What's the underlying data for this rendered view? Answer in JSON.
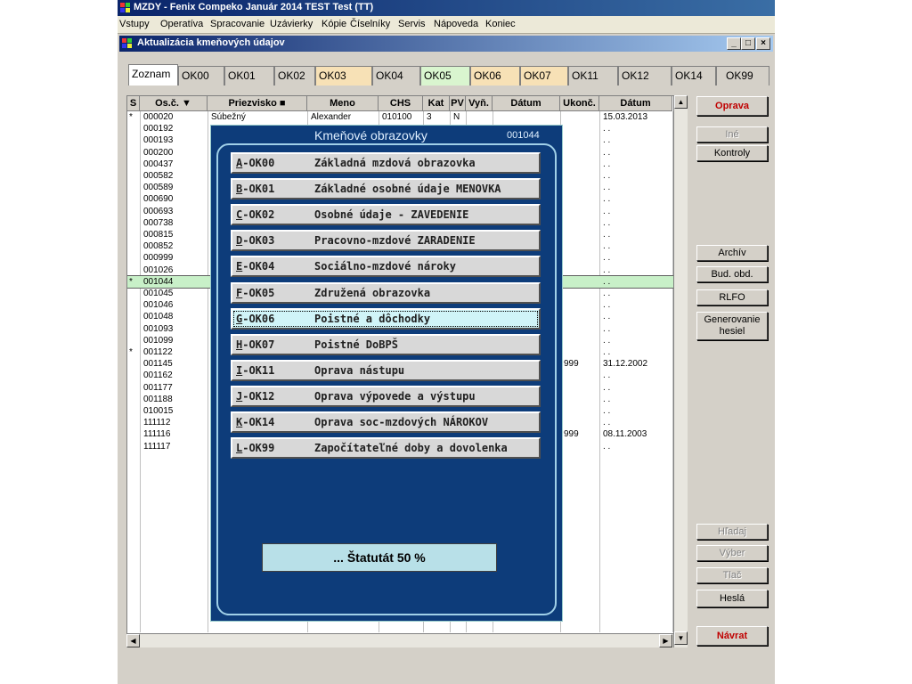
{
  "window": {
    "title": "MZDY - Fenix Compeko Január 2014   TEST Test (TT)"
  },
  "menu": [
    "Vstupy",
    "Operatíva",
    "Spracovanie",
    "Uzávierky",
    "Kópie",
    "Číselníky",
    "Servis",
    "Nápoveda",
    "Koniec"
  ],
  "inner_window": {
    "title": "Aktualizácia kmeňových údajov",
    "minimize": "_",
    "maximize": "□",
    "close": "×"
  },
  "tabs": [
    "Zoznam",
    "OK00",
    "OK01",
    "OK02",
    "OK03",
    "OK04",
    "OK05",
    "OK06",
    "OK07",
    "OK11",
    "OK12",
    "OK14",
    "OK99"
  ],
  "table": {
    "headers": [
      "S",
      "Os.č. ▼",
      "Priezvisko ■",
      "Meno",
      "CHS",
      "Kat",
      "PV",
      "Vyň.",
      "Dátum",
      "Ukonč.",
      "Dátum"
    ],
    "rows": [
      {
        "s": "*",
        "osc": "000020",
        "priezvisko": "Súbežný",
        "meno": "Alexander",
        "chs": "010100",
        "kat": "3",
        "pv": "N",
        "ukonc": "",
        "datum2": "15.03.2013"
      },
      {
        "s": "",
        "osc": "000192",
        "ukonc": "",
        "datum2": ". ."
      },
      {
        "s": "",
        "osc": "000193",
        "ukonc": "",
        "datum2": ". ."
      },
      {
        "s": "",
        "osc": "000200",
        "ukonc": "",
        "datum2": ". ."
      },
      {
        "s": "",
        "osc": "000437",
        "ukonc": "",
        "datum2": ". ."
      },
      {
        "s": "",
        "osc": "000582",
        "ukonc": "",
        "datum2": ". ."
      },
      {
        "s": "",
        "osc": "000589",
        "ukonc": "",
        "datum2": ". ."
      },
      {
        "s": "",
        "osc": "000690",
        "ukonc": "",
        "datum2": ". ."
      },
      {
        "s": "",
        "osc": "000693",
        "ukonc": "",
        "datum2": ". ."
      },
      {
        "s": "",
        "osc": "000738",
        "ukonc": "",
        "datum2": ". ."
      },
      {
        "s": "",
        "osc": "000815",
        "ukonc": "",
        "datum2": ". ."
      },
      {
        "s": "",
        "osc": "000852",
        "ukonc": "",
        "datum2": ". ."
      },
      {
        "s": "",
        "osc": "000999",
        "ukonc": "",
        "datum2": ". ."
      },
      {
        "s": "",
        "osc": "001026",
        "ukonc": "",
        "datum2": ". ."
      },
      {
        "s": "*",
        "osc": "001044",
        "ukonc": "",
        "datum2": ". .",
        "selected": true
      },
      {
        "s": "",
        "osc": "001045",
        "ukonc": "",
        "datum2": ". ."
      },
      {
        "s": "",
        "osc": "001046",
        "ukonc": "",
        "datum2": ". ."
      },
      {
        "s": "",
        "osc": "001048",
        "ukonc": "",
        "datum2": ". ."
      },
      {
        "s": "",
        "osc": "001093",
        "ukonc": "",
        "datum2": ". ."
      },
      {
        "s": "",
        "osc": "001099",
        "ukonc": "",
        "datum2": ". ."
      },
      {
        "s": "*",
        "osc": "001122",
        "ukonc": "",
        "datum2": ". ."
      },
      {
        "s": "",
        "osc": "001145",
        "ukonc": "999",
        "datum2": "31.12.2002"
      },
      {
        "s": "",
        "osc": "001162",
        "ukonc": "",
        "datum2": ". ."
      },
      {
        "s": "",
        "osc": "001177",
        "ukonc": "",
        "datum2": ". ."
      },
      {
        "s": "",
        "osc": "001188",
        "ukonc": "",
        "datum2": ". ."
      },
      {
        "s": "",
        "osc": "010015",
        "ukonc": "",
        "datum2": ". ."
      },
      {
        "s": "",
        "osc": "111112",
        "ukonc": "",
        "datum2": ". ."
      },
      {
        "s": "",
        "osc": "111116",
        "ukonc": "999",
        "datum2": "08.11.2003"
      },
      {
        "s": "",
        "osc": "111117",
        "ukonc": "",
        "datum2": ". ."
      }
    ]
  },
  "right_buttons": [
    {
      "label": "Oprava",
      "style": "red"
    },
    {
      "label": "Iné",
      "style": "dis"
    },
    {
      "label": "Kontroly",
      "style": ""
    },
    {
      "label": "Archív",
      "style": ""
    },
    {
      "label": "Bud. obd.",
      "style": ""
    },
    {
      "label": "RLFO",
      "style": ""
    },
    {
      "label": "Generovanie hesiel",
      "style": ""
    },
    {
      "label": "Hľadaj",
      "style": "dis"
    },
    {
      "label": "Výber",
      "style": "dis"
    },
    {
      "label": "Tlač",
      "style": "dis"
    },
    {
      "label": "Heslá",
      "style": ""
    },
    {
      "label": "Návrat",
      "style": "red"
    }
  ],
  "popup": {
    "title": "Kmeňové obrazovky",
    "code": "001044",
    "items": [
      {
        "key": "A",
        "code": "-OK00",
        "label": "Základná mzdová obrazovka"
      },
      {
        "key": "B",
        "code": "-OK01",
        "label": "Základné osobné údaje  MENOVKA"
      },
      {
        "key": "C",
        "code": "-OK02",
        "label": "Osobné údaje  -  ZAVEDENIE"
      },
      {
        "key": "D",
        "code": "-OK03",
        "label": "Pracovno-mzdové  ZARADENIE"
      },
      {
        "key": "E",
        "code": "-OK04",
        "label": "Sociálno-mzdové nároky"
      },
      {
        "key": "F",
        "code": "-OK05",
        "label": "Združená obrazovka"
      },
      {
        "key": "G",
        "code": "-OK06",
        "label": "Poistné a dôchodky",
        "selected": true
      },
      {
        "key": "H",
        "code": "-OK07",
        "label": "Poistné DoBPŠ"
      },
      {
        "key": "I",
        "code": "-OK11",
        "label": "Oprava nástupu"
      },
      {
        "key": "J",
        "code": "-OK12",
        "label": "Oprava výpovede a výstupu"
      },
      {
        "key": "K",
        "code": "-OK14",
        "label": "Oprava soc-mzdových  NÁROKOV"
      },
      {
        "key": "L",
        "code": "-OK99",
        "label": "Započítateľné doby a dovolenka"
      }
    ],
    "status": "... Štatutát 50 %"
  },
  "colors": {
    "titlebar": "#0a246a",
    "popup_bg": "#0d3c7a",
    "selected_row": "#c8f0c8",
    "red_label": "#c00000"
  }
}
